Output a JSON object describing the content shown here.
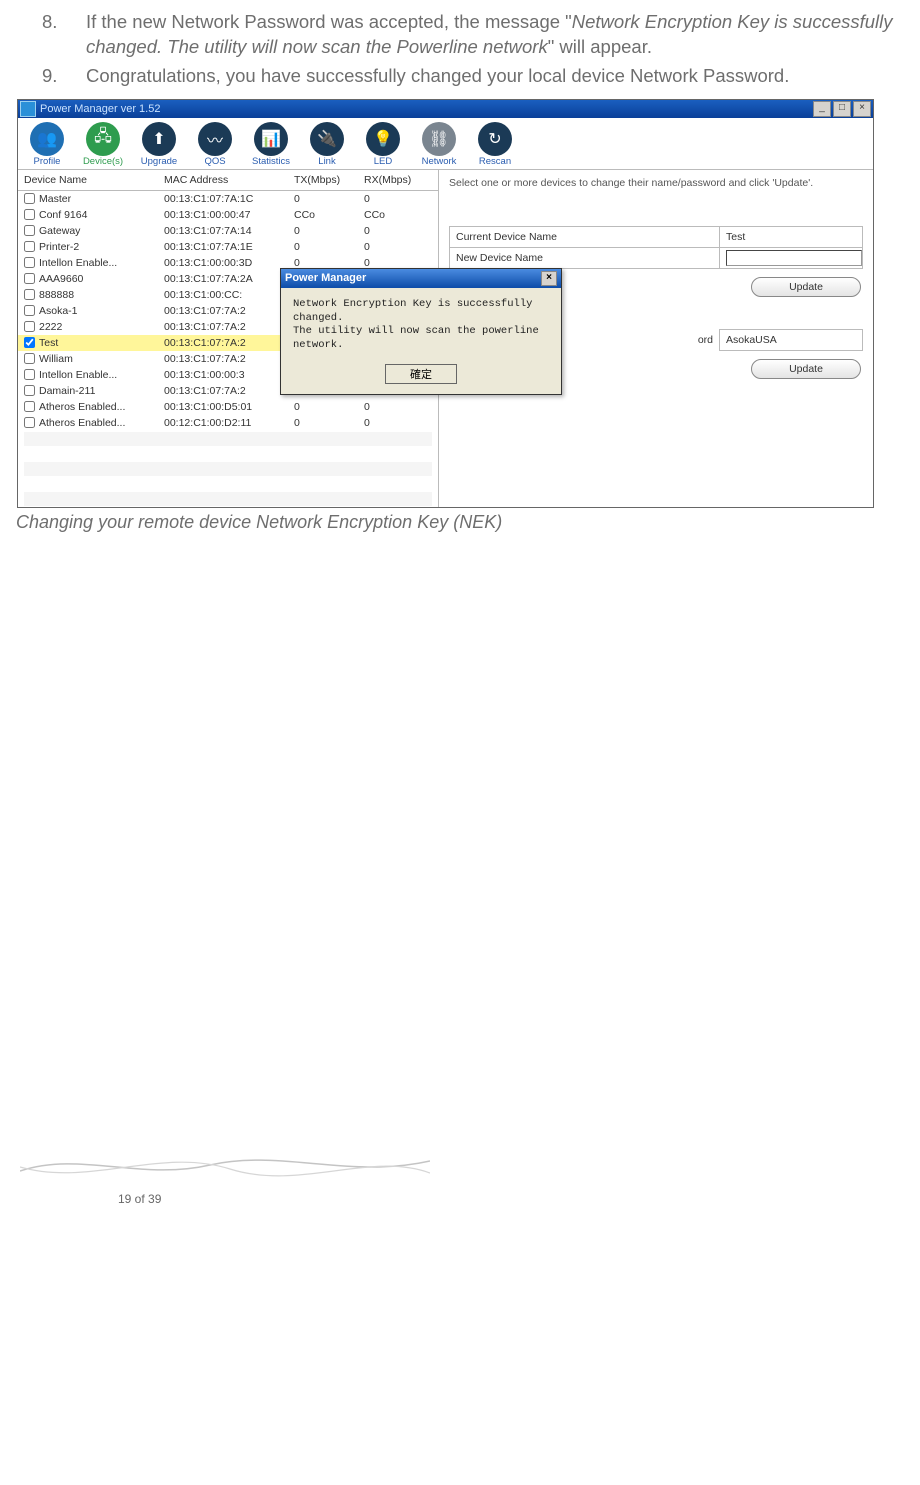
{
  "list": {
    "item8_num": "8.",
    "item8_a": "If the new Network Password was accepted, the message \"",
    "item8_msg": "Network Encryption Key is successfully changed. The utility will now scan the Powerline network",
    "item8_b": "\" will appear.",
    "item9_num": "9.",
    "item9": "Congratulations, you have successfully changed your local device Network Password."
  },
  "win": {
    "title": "Power Manager ver 1.52",
    "btn_min": "_",
    "btn_max": "□",
    "btn_close": "×"
  },
  "toolbar": {
    "profile": "Profile",
    "devices": "Device(s)",
    "upgrade": "Upgrade",
    "qos": "QOS",
    "statistics": "Statistics",
    "link": "Link",
    "led": "LED",
    "network": "Network",
    "rescan": "Rescan"
  },
  "cols": {
    "name": "Device Name",
    "mac": "MAC Address",
    "tx": "TX(Mbps)",
    "rx": "RX(Mbps)"
  },
  "rows": [
    {
      "name": "Master",
      "mac": "00:13:C1:07:7A:1C",
      "tx": "0",
      "rx": "0",
      "chk": false
    },
    {
      "name": "Conf 9164",
      "mac": "00:13:C1:00:00:47",
      "tx": "CCo",
      "rx": "CCo",
      "chk": false
    },
    {
      "name": "Gateway",
      "mac": "00:13:C1:07:7A:14",
      "tx": "0",
      "rx": "0",
      "chk": false
    },
    {
      "name": "Printer-2",
      "mac": "00:13:C1:07:7A:1E",
      "tx": "0",
      "rx": "0",
      "chk": false
    },
    {
      "name": "Intellon Enable...",
      "mac": "00:13:C1:00:00:3D",
      "tx": "0",
      "rx": "0",
      "chk": false
    },
    {
      "name": "AAA9660",
      "mac": "00:13:C1:07:7A:2A",
      "tx": "0",
      "rx": "0",
      "chk": false
    },
    {
      "name": "888888",
      "mac": "00:13:C1:00:CC:",
      "tx": "",
      "rx": "",
      "chk": false
    },
    {
      "name": "Asoka-1",
      "mac": "00:13:C1:07:7A:2",
      "tx": "",
      "rx": "",
      "chk": false
    },
    {
      "name": "2222",
      "mac": "00:13:C1:07:7A:2",
      "tx": "",
      "rx": "",
      "chk": false
    },
    {
      "name": "Test",
      "mac": "00:13:C1:07:7A:2",
      "tx": "",
      "rx": "",
      "chk": true,
      "sel": true
    },
    {
      "name": "William",
      "mac": "00:13:C1:07:7A:2",
      "tx": "",
      "rx": "",
      "chk": false
    },
    {
      "name": "Intellon Enable...",
      "mac": "00:13:C1:00:00:3",
      "tx": "",
      "rx": "",
      "chk": false
    },
    {
      "name": "Damain-211",
      "mac": "00:13:C1:07:7A:2",
      "tx": "",
      "rx": "",
      "chk": false
    },
    {
      "name": "Atheros Enabled...",
      "mac": "00:13:C1:00:D5:01",
      "tx": "0",
      "rx": "0",
      "chk": false
    },
    {
      "name": "Atheros Enabled...",
      "mac": "00:12:C1:00:D2:11",
      "tx": "0",
      "rx": "0",
      "chk": false
    }
  ],
  "right": {
    "hint": "Select one or more devices to change their name/password and click 'Update'.",
    "curlabel": "Current Device Name",
    "curval": "Test",
    "newlabel": "New Device Name",
    "newval": "",
    "pwd_tail": "ord",
    "pwdval": "AsokaUSA",
    "update": "Update"
  },
  "dialog": {
    "title": "Power Manager",
    "line1": "Network Encryption Key is successfully changed.",
    "line2": "The utility will now scan the powerline network.",
    "ok": "確定"
  },
  "caption": "Changing your remote device Network Encryption Key (NEK)",
  "pagenum": "19 of 39"
}
